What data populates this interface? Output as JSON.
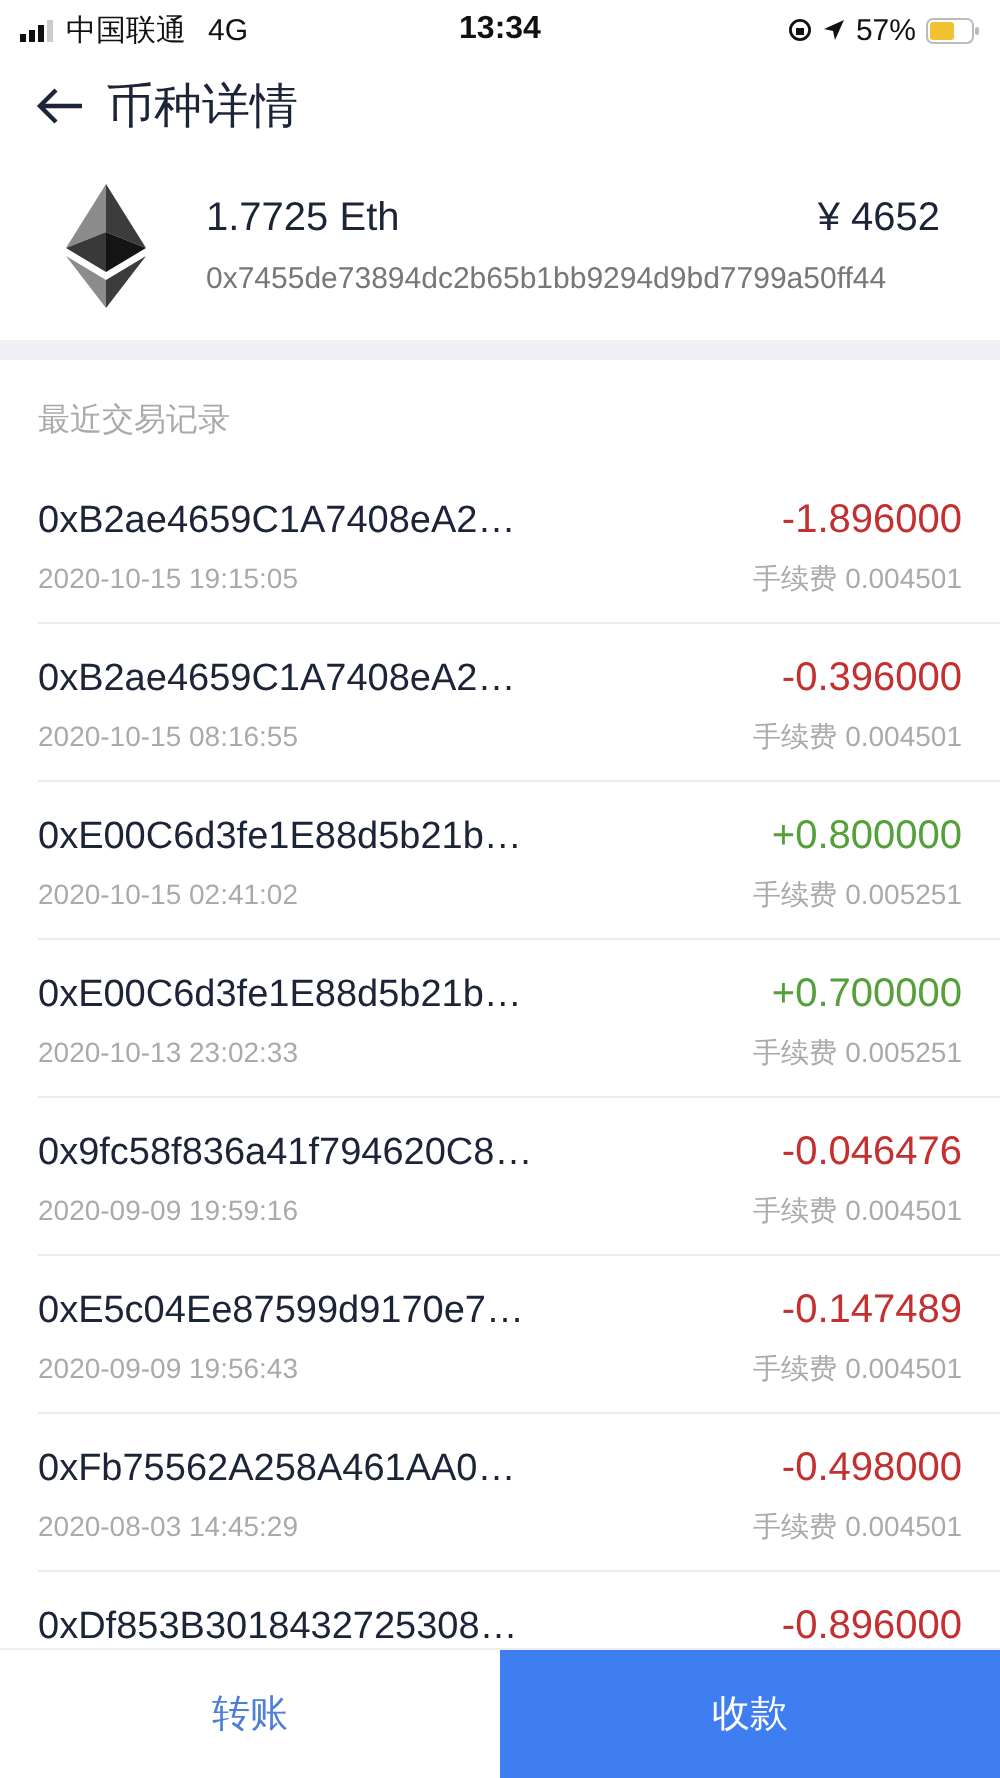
{
  "status_bar": {
    "carrier": "中国联通",
    "network": "4G",
    "time": "13:34",
    "battery": "57%"
  },
  "header": {
    "title": "币种详情"
  },
  "coin": {
    "balance": "1.7725 Eth",
    "value": "¥ 4652",
    "address": "0x7455de73894dc2b65b1bb9294d9bd7799a50ff44"
  },
  "section_title": "最近交易记录",
  "transactions": [
    {
      "hash": "0xB2ae4659C1A7408eA2…",
      "amount": "-1.896000",
      "kind": "out",
      "time": "2020-10-15 19:15:05",
      "fee": "手续费 0.004501"
    },
    {
      "hash": "0xB2ae4659C1A7408eA2…",
      "amount": "-0.396000",
      "kind": "out",
      "time": "2020-10-15 08:16:55",
      "fee": "手续费 0.004501"
    },
    {
      "hash": "0xE00C6d3fe1E88d5b21b…",
      "amount": "+0.800000",
      "kind": "in",
      "time": "2020-10-15 02:41:02",
      "fee": "手续费 0.005251"
    },
    {
      "hash": "0xE00C6d3fe1E88d5b21b…",
      "amount": "+0.700000",
      "kind": "in",
      "time": "2020-10-13 23:02:33",
      "fee": "手续费 0.005251"
    },
    {
      "hash": "0x9fc58f836a41f794620C8…",
      "amount": "-0.046476",
      "kind": "out",
      "time": "2020-09-09 19:59:16",
      "fee": "手续费 0.004501"
    },
    {
      "hash": "0xE5c04Ee87599d9170e7…",
      "amount": "-0.147489",
      "kind": "out",
      "time": "2020-09-09 19:56:43",
      "fee": "手续费 0.004501"
    },
    {
      "hash": "0xFb75562A258A461AA0…",
      "amount": "-0.498000",
      "kind": "out",
      "time": "2020-08-03 14:45:29",
      "fee": "手续费 0.004501"
    },
    {
      "hash": "0xDf853B3018432725308…",
      "amount": "-0.896000",
      "kind": "out"
    }
  ],
  "bottom_buttons": [
    {
      "label": "转账",
      "selected": false
    },
    {
      "label": "收款",
      "selected": true
    }
  ]
}
